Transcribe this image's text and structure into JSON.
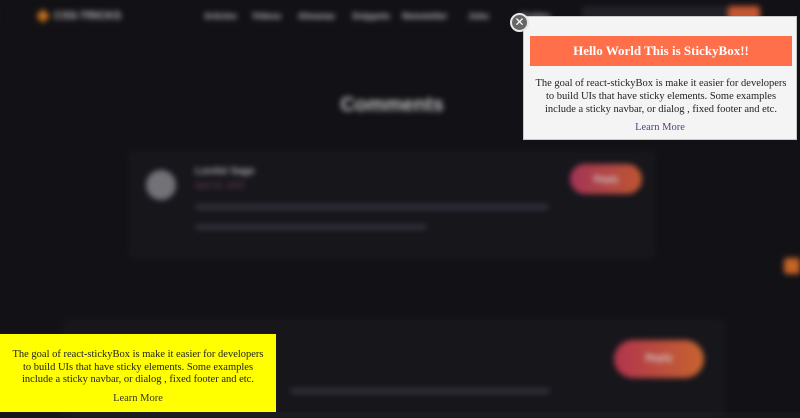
{
  "background": {
    "site_name": "CSS-TRICKS",
    "nav_links": [
      "Articles",
      "Videos",
      "Almanac",
      "Snippets",
      "Newsletter",
      "Jobs",
      "Guides"
    ],
    "heading": "Comments",
    "comment": {
      "author": "Lorelei Sage",
      "date": "April 23, 2020",
      "reply_label": "Reply"
    },
    "reply_label_2": "Reply"
  },
  "sticky_popup": {
    "title": "Hello World This is StickyBox!!",
    "body": "The goal of react-stickyBox is make it easier for developers to build UIs that have sticky elements. Some examples include a sticky navbar, or dialog , fixed footer and etc.",
    "link": "Learn More",
    "close_symbol": "✕",
    "title_color": "#ff6f4a"
  },
  "sticky_footer": {
    "body": "The goal of react-stickyBox is make it easier for developers to build UIs that have sticky elements. Some examples include a sticky navbar, or dialog , fixed footer and etc.",
    "link": "Learn More",
    "background_color": "#ffff00"
  }
}
